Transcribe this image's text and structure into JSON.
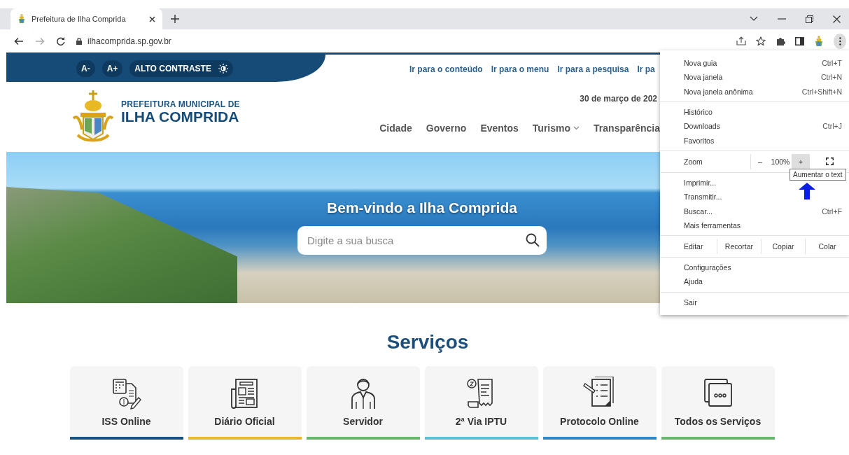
{
  "browser": {
    "tab": {
      "title": "Prefeitura de Ilha Comprida",
      "selected": true
    },
    "address": "ilhacomprida.sp.gov.br",
    "menu_open": true
  },
  "accessibility_bar": {
    "buttons": [
      "A-",
      "A+"
    ],
    "contrast": "ALTO CONTRASTE"
  },
  "skip_links": [
    "Ir para o conteúdo",
    "Ir para o menu",
    "Ir para a pesquisa",
    "Ir pa"
  ],
  "header": {
    "subtitle": "PREFEITURA MUNICIPAL DE",
    "title": "ILHA COMPRIDA",
    "date": "30 de março de 202"
  },
  "nav": [
    {
      "label": "Cidade",
      "has_submenu": false
    },
    {
      "label": "Governo",
      "has_submenu": false
    },
    {
      "label": "Eventos",
      "has_submenu": false
    },
    {
      "label": "Turismo",
      "has_submenu": true
    },
    {
      "label": "Transparência",
      "has_submenu": false
    }
  ],
  "hero": {
    "heading": "Bem-vindo a Ilha Comprida",
    "search": {
      "placeholder": "Digite a sua busca"
    }
  },
  "services": {
    "title": "Serviços",
    "items": [
      {
        "label": "ISS Online",
        "color": "#1d4f7c",
        "kind": "calculator"
      },
      {
        "label": "Diário Oficial",
        "color": "#e8b730",
        "kind": "newspaper"
      },
      {
        "label": "Servidor",
        "color": "#6bb56f",
        "kind": "person"
      },
      {
        "label": "2ª Via IPTU",
        "color": "#5bbfd6",
        "kind": "receipt"
      },
      {
        "label": "Protocolo Online",
        "color": "#2f86c8",
        "kind": "clipboard"
      },
      {
        "label": "Todos os Serviços",
        "color": "#6bb56f",
        "kind": "more"
      }
    ]
  },
  "menu": {
    "groups": [
      [
        {
          "kind": "item",
          "label": "Nova guia",
          "shortcut": "Ctrl+T"
        },
        {
          "kind": "item",
          "label": "Nova janela",
          "shortcut": "Ctrl+N"
        },
        {
          "kind": "item",
          "label": "Nova janela anônima",
          "shortcut": "Ctrl+Shift+N"
        }
      ],
      [
        {
          "kind": "item",
          "label": "Histórico"
        },
        {
          "kind": "item",
          "label": "Downloads",
          "shortcut": "Ctrl+J"
        },
        {
          "kind": "item",
          "label": "Favoritos"
        }
      ],
      [
        {
          "kind": "zoom",
          "label": "Zoom",
          "minus": "–",
          "value": "100%",
          "plus": "+",
          "plus_hovered": true
        }
      ],
      [
        {
          "kind": "item",
          "label": "Imprimir..."
        },
        {
          "kind": "item",
          "label": "Transmitir..."
        },
        {
          "kind": "item",
          "label": "Buscar...",
          "shortcut": "Ctrl+F"
        },
        {
          "kind": "item",
          "label": "Mais ferramentas"
        }
      ],
      [
        {
          "kind": "edit",
          "label": "Editar",
          "actions": [
            "Recortar",
            "Copiar",
            "Colar"
          ]
        }
      ],
      [
        {
          "kind": "item",
          "label": "Configurações"
        },
        {
          "kind": "item",
          "label": "Ajuda"
        }
      ],
      [
        {
          "kind": "item",
          "label": "Sair"
        }
      ]
    ]
  },
  "tooltip": "Aumentar o text"
}
